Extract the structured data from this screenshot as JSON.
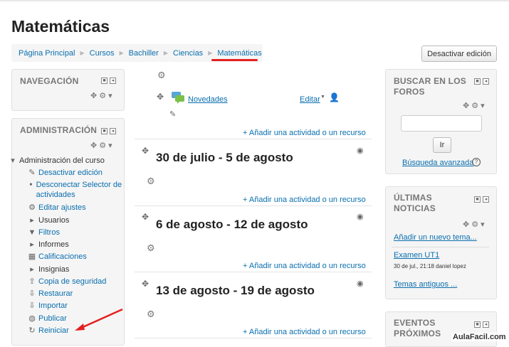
{
  "page": {
    "title": "Matemáticas",
    "edit_button": "Desactivar edición"
  },
  "breadcrumb": [
    "Página Principal",
    "Cursos",
    "Bachiller",
    "Ciencias",
    "Matemáticas"
  ],
  "navigation": {
    "title": "NAVEGACIÓN"
  },
  "administration": {
    "title": "ADMINISTRACIÓN",
    "items": [
      {
        "label": "Administración del curso",
        "icon": "caret-down-icon"
      },
      {
        "label": "Desactivar edición",
        "icon": "pencil-icon"
      },
      {
        "label": "Desconectar Selector de actividades",
        "icon": "bullet-icon"
      },
      {
        "label": "Editar ajustes",
        "icon": "gear-icon"
      },
      {
        "label": "Usuarios",
        "icon": "caret-right-icon"
      },
      {
        "label": "Filtros",
        "icon": "filter-icon"
      },
      {
        "label": "Informes",
        "icon": "caret-right-icon"
      },
      {
        "label": "Calificaciones",
        "icon": "table-icon"
      },
      {
        "label": "Insignias",
        "icon": "caret-right-icon"
      },
      {
        "label": "Copia de seguridad",
        "icon": "backup-icon"
      },
      {
        "label": "Restaurar",
        "icon": "restore-icon"
      },
      {
        "label": "Importar",
        "icon": "import-icon"
      },
      {
        "label": "Publicar",
        "icon": "globe-icon"
      },
      {
        "label": "Reiniciar",
        "icon": "reset-icon"
      }
    ]
  },
  "center": {
    "forum": {
      "label": "Novedades",
      "edit": "Editar"
    },
    "add_activity": "Añadir una actividad o un recurso",
    "sections": [
      {
        "title": "30 de julio - 5 de agosto"
      },
      {
        "title": "6 de agosto - 12 de agosto"
      },
      {
        "title": "13 de agosto - 19 de agosto"
      }
    ]
  },
  "search_forums": {
    "title": "BUSCAR EN LOS FOROS",
    "button": "Ir",
    "advanced": "Búsqueda avanzada"
  },
  "news": {
    "title": "ÚLTIMAS NOTICIAS",
    "add": "Añadir un nuevo tema...",
    "item_title": "Examen UT1",
    "item_meta": "30 de jul., 21:18 daniel lopez",
    "older": "Temas antiguos ..."
  },
  "events": {
    "title": "EVENTOS PRÓXIMOS"
  },
  "watermark": "AulaFacil.com",
  "colors": {
    "link": "#0a6fae",
    "annotation": "#e52020"
  }
}
